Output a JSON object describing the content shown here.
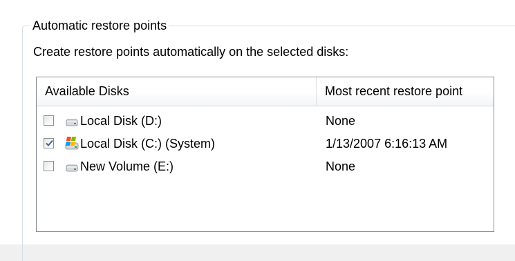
{
  "group": {
    "title": "Automatic restore points",
    "instruction": "Create restore points automatically on the selected disks:"
  },
  "listview": {
    "columns": {
      "disks": "Available Disks",
      "recent": "Most recent restore point"
    },
    "rows": [
      {
        "label": "Local Disk (D:)",
        "recent": "None",
        "checked": false,
        "icon": "hard-drive-icon"
      },
      {
        "label": "Local Disk (C:) (System)",
        "recent": "1/13/2007 6:16:13 AM",
        "checked": true,
        "icon": "system-drive-icon"
      },
      {
        "label": "New Volume (E:)",
        "recent": "None",
        "checked": false,
        "icon": "hard-drive-icon"
      }
    ]
  },
  "colors": {
    "check_mark": "#4a5f97",
    "drive_body": "#d7dadf",
    "drive_led": "#3aa23a",
    "windows_red": "#f25022",
    "windows_green": "#7fba00",
    "windows_blue": "#00a4ef",
    "windows_yellow": "#ffb900"
  }
}
